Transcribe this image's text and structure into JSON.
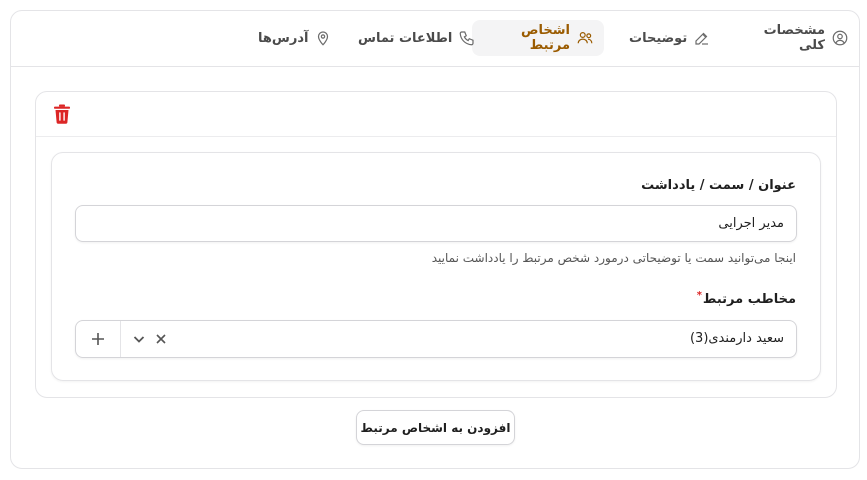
{
  "tabs": [
    {
      "label": "مشخصات کلی",
      "icon": "user-circle-icon",
      "active": false
    },
    {
      "label": "توضیحات",
      "icon": "edit-icon",
      "active": false
    },
    {
      "label": "اشخاص مرتبط",
      "icon": "users-icon",
      "active": true
    },
    {
      "label": "اطلاعات تماس",
      "icon": "phone-icon",
      "active": false
    },
    {
      "label": "آدرس‌ها",
      "icon": "location-pin-icon",
      "active": false
    }
  ],
  "colors": {
    "accent": "#9a5b00",
    "delete": "#dc2626",
    "required": "#dc2626",
    "border": "#e4e4e7"
  },
  "related_person": {
    "delete_icon": "trash-icon",
    "title_label": "عنوان / سمت / یادداشت",
    "title_value": "مدیر اجرایی",
    "title_hint": "اینجا می‌توانید سمت یا توضیحاتی درمورد شخص مرتبط را یادداشت نمایید",
    "contact_label": "مخاطب مرتبط",
    "contact_required_mark": "*",
    "contact_value": "سعید دارمندی(3)"
  },
  "add_button_label": "افزودن به اشخاص مرتبط"
}
